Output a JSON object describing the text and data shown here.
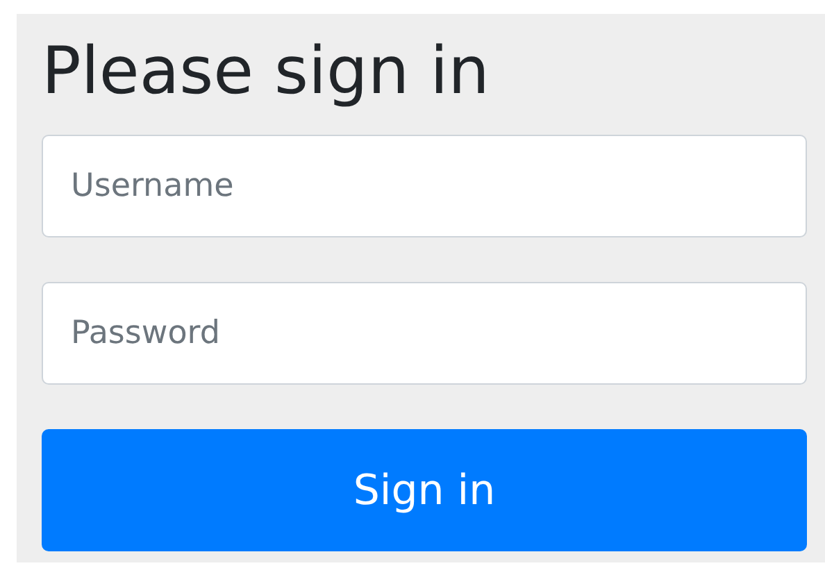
{
  "heading": "Please sign in",
  "fields": [
    {
      "placeholder": "Username"
    },
    {
      "placeholder": "Password"
    }
  ],
  "button": "Sign in"
}
